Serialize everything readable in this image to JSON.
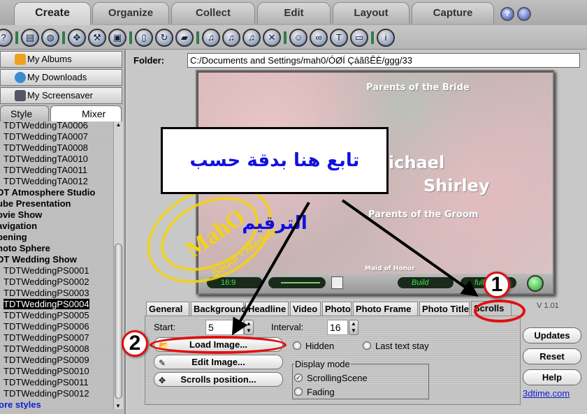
{
  "main_tabs": [
    {
      "label": "Create",
      "active": true
    },
    {
      "label": "Organize"
    },
    {
      "label": "Collect"
    },
    {
      "label": "Edit"
    },
    {
      "label": "Layout"
    },
    {
      "label": "Capture"
    }
  ],
  "top_icons": [
    "help-icon",
    "settings-icon"
  ],
  "toolbar_icons": [
    "help-icon",
    "briefcase-icon",
    "globe-icon",
    "move-icon",
    "hammer-icon",
    "frame-icon",
    "phone-icon",
    "refresh-icon",
    "folder-icon",
    "music-icon",
    "music-add-icon",
    "music-gray-icon",
    "music-delete-icon",
    "user-icon",
    "link-icon",
    "text-icon",
    "window-icon",
    "info-icon"
  ],
  "sidebar": {
    "buttons": [
      {
        "label": "My Albums"
      },
      {
        "label": "My Downloads"
      },
      {
        "label": "My Screensaver"
      }
    ],
    "tabs": [
      {
        "label": "Style",
        "active": true
      },
      {
        "label": "Mixer"
      }
    ],
    "items": [
      {
        "label": "TDTWeddingTA0006",
        "type": "item"
      },
      {
        "label": "TDTWeddingTA0007",
        "type": "item"
      },
      {
        "label": "TDTWeddingTA0008",
        "type": "item"
      },
      {
        "label": "TDTWeddingTA0010",
        "type": "item"
      },
      {
        "label": "TDTWeddingTA0011",
        "type": "item"
      },
      {
        "label": "TDTWeddingTA0012",
        "type": "item"
      },
      {
        "label": "DT Atmosphere Studio",
        "type": "group"
      },
      {
        "label": "ube Presentation",
        "type": "group"
      },
      {
        "label": "ovie Show",
        "type": "group"
      },
      {
        "label": "avigation",
        "type": "group"
      },
      {
        "label": "pening",
        "type": "group"
      },
      {
        "label": "hoto Sphere",
        "type": "group"
      },
      {
        "label": "DT Wedding Show",
        "type": "group"
      },
      {
        "label": "TDTWeddingPS0001",
        "type": "item"
      },
      {
        "label": "TDTWeddingPS0002",
        "type": "item"
      },
      {
        "label": "TDTWeddingPS0003",
        "type": "item"
      },
      {
        "label": "TDTWeddingPS0004",
        "type": "item",
        "selected": true
      },
      {
        "label": "TDTWeddingPS0005",
        "type": "item"
      },
      {
        "label": "TDTWeddingPS0006",
        "type": "item"
      },
      {
        "label": "TDTWeddingPS0007",
        "type": "item"
      },
      {
        "label": "TDTWeddingPS0008",
        "type": "item"
      },
      {
        "label": "TDTWeddingPS0009",
        "type": "item"
      },
      {
        "label": "TDTWeddingPS0010",
        "type": "item"
      },
      {
        "label": "TDTWeddingPS0011",
        "type": "item"
      },
      {
        "label": "TDTWeddingPS0012",
        "type": "item"
      }
    ],
    "more_link": "ore styles"
  },
  "folder": {
    "label": "Folder:",
    "value": "C:/Documents and Settings/mah0/ÓØÍ ÇáãßÊÈ/ggg/33"
  },
  "preview": {
    "line1": "Parents of the Bride",
    "name1": "ichael",
    "name2": "Shirley",
    "line2": "Parents of the Groom",
    "line3": "Maid of Honor",
    "aspect": "16:9",
    "build": "Build",
    "full": "full"
  },
  "stamp": {
    "text": "MahO",
    "sub": "Saudi - Medina",
    "year": "2008",
    "top": "ABU"
  },
  "callout": "تابع هنا بدقة حسب الترقيم",
  "prop_tabs": [
    "General",
    "Background",
    "Headline",
    "Video",
    "Photo",
    "Photo Frame",
    "Photo Title",
    "Scrolls"
  ],
  "active_prop_tab": "Scrolls",
  "version": "V 1.01",
  "panel": {
    "start_label": "Start:",
    "start_value": "5",
    "interval_label": "Interval:",
    "interval_value": "16",
    "load_image": "Load Image...",
    "edit_image": "Edit Image...",
    "scrolls_position": "Scrolls position...",
    "hidden": "Hidden",
    "last_text_stay": "Last text stay",
    "display_mode": "Display mode",
    "scrolling_scene": "ScrollingScene",
    "fading": "Fading",
    "display_mode_selected": "ScrollingScene"
  },
  "right_buttons": {
    "updates": "Updates",
    "reset": "Reset",
    "help": "Help",
    "link": "3dtime.com"
  },
  "annotations": {
    "step1": "1",
    "step2": "2"
  },
  "colors": {
    "accent": "#e01010",
    "callout_text": "#1010e0",
    "link": "#1020d0",
    "stamp": "#f2d21a"
  }
}
